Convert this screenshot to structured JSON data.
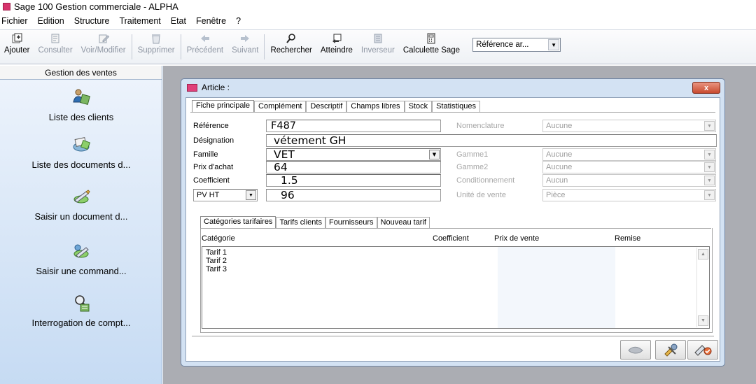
{
  "window": {
    "title": "Sage 100 Gestion commerciale - ALPHA"
  },
  "menu": [
    "Fichier",
    "Edition",
    "Structure",
    "Traitement",
    "Etat",
    "Fenêtre",
    "?"
  ],
  "toolbar": {
    "buttons": [
      {
        "label": "Ajouter",
        "icon": "add-record-icon",
        "enabled": true
      },
      {
        "label": "Consulter",
        "icon": "view-record-icon",
        "enabled": false
      },
      {
        "label": "Voir/Modifier",
        "icon": "edit-record-icon",
        "enabled": false
      },
      {
        "label": "Supprimer",
        "icon": "trash-icon",
        "enabled": false
      },
      {
        "label": "Précédent",
        "icon": "arrow-left-icon",
        "enabled": false
      },
      {
        "label": "Suivant",
        "icon": "arrow-right-icon",
        "enabled": false
      },
      {
        "label": "Rechercher",
        "icon": "search-icon",
        "enabled": true
      },
      {
        "label": "Atteindre",
        "icon": "goto-icon",
        "enabled": true
      },
      {
        "label": "Inverseur",
        "icon": "toggle-icon",
        "enabled": false
      },
      {
        "label": "Calculette Sage",
        "icon": "calculator-icon",
        "enabled": true
      }
    ],
    "reference_select": "Référence ar..."
  },
  "sidebar": {
    "header": "Gestion des ventes",
    "items": [
      {
        "label": "Liste des clients",
        "icon": "clients-icon"
      },
      {
        "label": "Liste des documents d...",
        "icon": "documents-icon"
      },
      {
        "label": "Saisir un document d...",
        "icon": "enter-document-icon"
      },
      {
        "label": "Saisir une command...",
        "icon": "enter-order-icon"
      },
      {
        "label": "Interrogation de compt...",
        "icon": "account-query-icon"
      }
    ]
  },
  "article": {
    "title": "Article :",
    "close_label": "x",
    "tabs": [
      "Fiche principale",
      "Complément",
      "Descriptif",
      "Champs libres",
      "Stock",
      "Statistiques"
    ],
    "fields": {
      "reference_label": "Référence",
      "reference_value": "F487",
      "designation_label": "Désignation",
      "designation_value": "vétement GH",
      "famille_label": "Famille",
      "famille_value": "VET",
      "prix_achat_label": "Prix d'achat",
      "prix_achat_value": "64",
      "coefficient_label": "Coefficient",
      "coefficient_value": "1.5",
      "pv_type": "PV HT",
      "pv_value": "96",
      "nomenclature_label": "Nomenclature",
      "nomenclature_value": "Aucune",
      "gamme1_label": "Gamme1",
      "gamme1_value": "Aucune",
      "gamme2_label": "Gamme2",
      "gamme2_value": "Aucune",
      "conditionnement_label": "Conditionnement",
      "conditionnement_value": "Aucun",
      "unite_label": "Unité de vente",
      "unite_value": "Pièce"
    },
    "inner_tabs": [
      "Catégories tarifaires",
      "Tarifs clients",
      "Fournisseurs",
      "Nouveau tarif"
    ],
    "columns": [
      "Catégorie",
      "Coefficient",
      "Prix de vente",
      "Remise"
    ],
    "rows": [
      "Tarif 1",
      "Tarif 2",
      "Tarif 3"
    ]
  },
  "colors": {
    "accent": "#d6336c",
    "sidebar": "#c6dbf3",
    "window_frame": "#d3e2f3"
  }
}
